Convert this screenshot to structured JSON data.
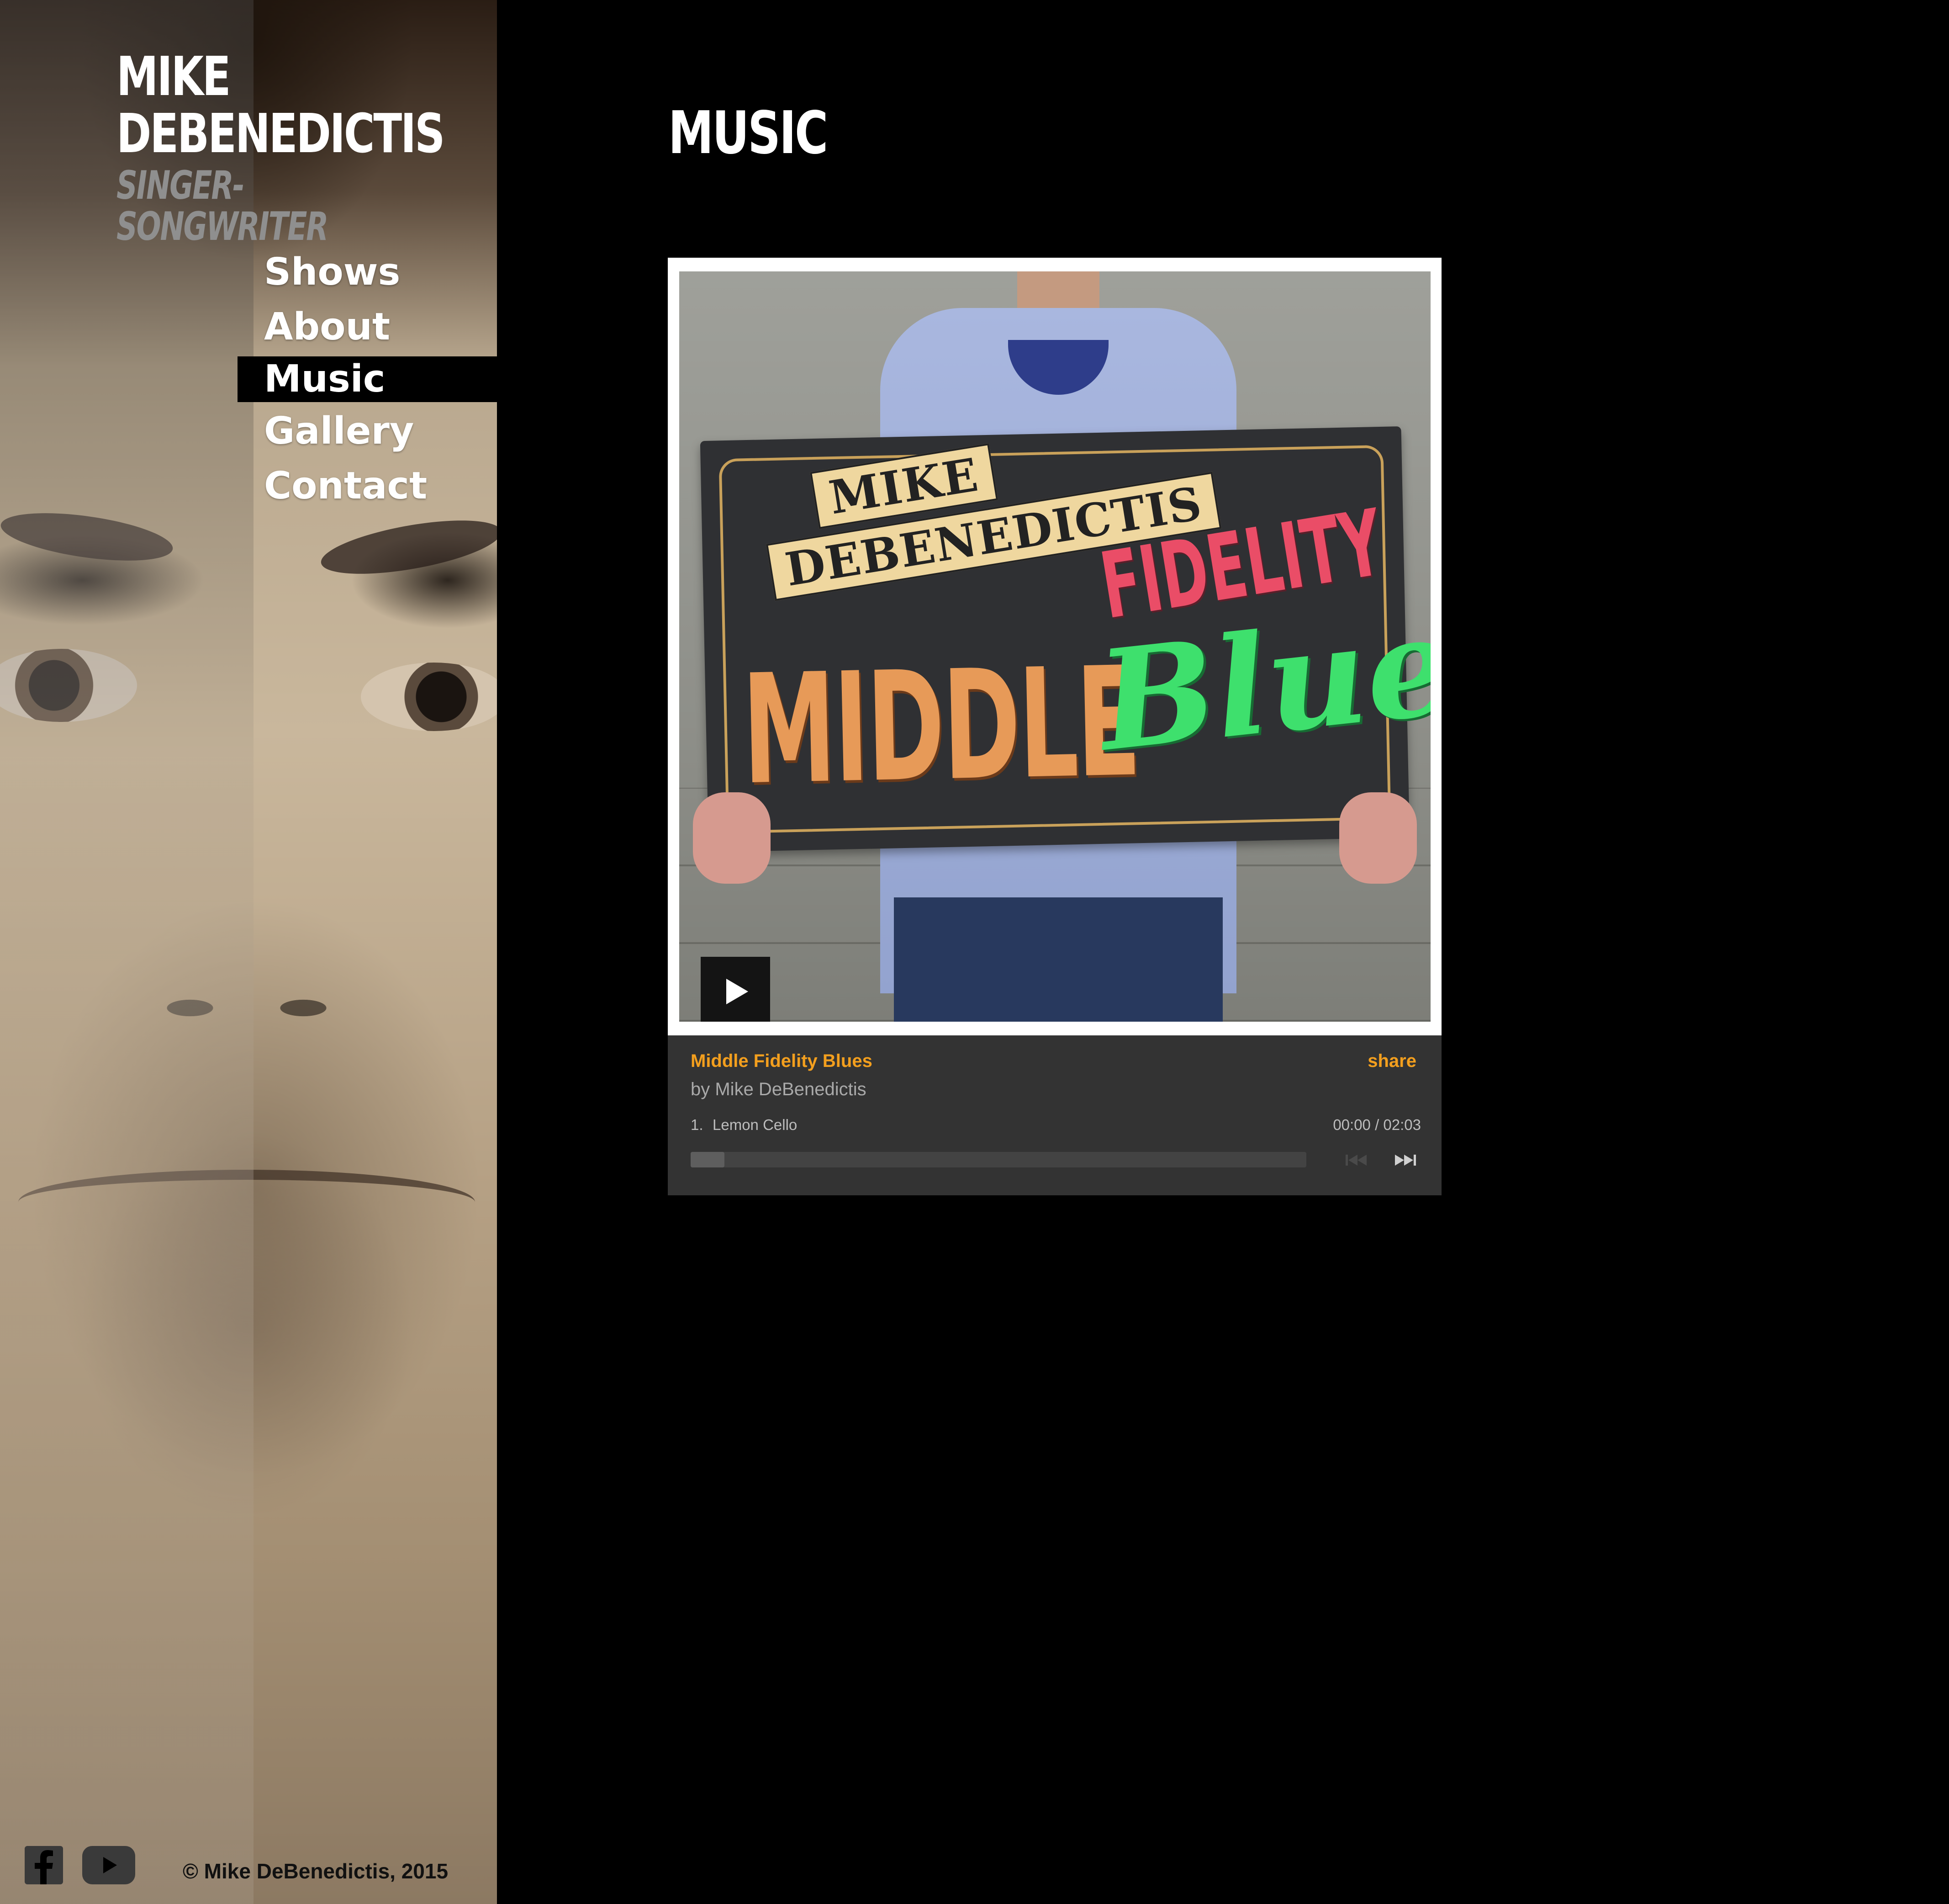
{
  "brand": {
    "name_line1": "MIKE",
    "name_line2": "DEBENEDICTIS",
    "tagline": "SINGER-SONGWRITER"
  },
  "nav": {
    "items": [
      {
        "label": "Shows"
      },
      {
        "label": "About"
      },
      {
        "label": "Music",
        "active": true
      },
      {
        "label": "Gallery"
      },
      {
        "label": "Contact"
      }
    ]
  },
  "page": {
    "title": "MUSIC"
  },
  "album_art": {
    "banner_line1": "MIKE",
    "banner_line2": "DEBENEDICTIS",
    "word1": "MIDDLE",
    "word2": "FIDELITY",
    "word3": "Blues"
  },
  "player": {
    "album_title": "Middle Fidelity Blues",
    "share_label": "share",
    "artist_line": "by Mike DeBenedictis",
    "track_number": "1.",
    "track_name": "Lemon Cello",
    "time": "00:00 / 02:03",
    "progress": 0
  },
  "footer": {
    "copyright": "© Mike DeBenedictis, 2015"
  },
  "icons": {
    "facebook": "facebook-icon",
    "youtube": "youtube-icon",
    "play": "play-icon",
    "prev": "previous-track-icon",
    "next": "next-track-icon"
  },
  "colors": {
    "accent": "#f39f1e",
    "panel": "#333333",
    "background": "#000000"
  }
}
